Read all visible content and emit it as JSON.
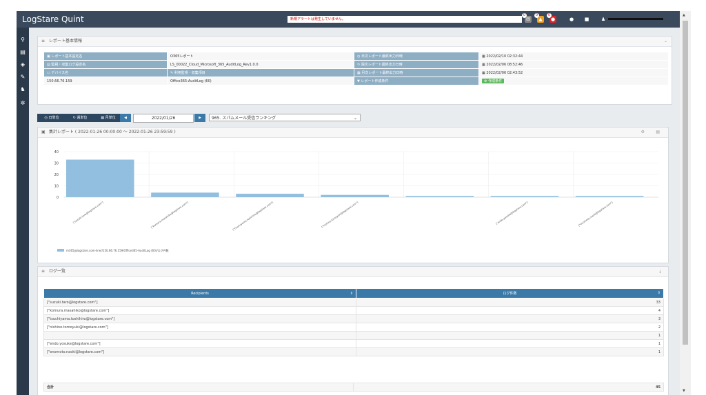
{
  "app": {
    "title": "LogStare Quint",
    "alert": "新規アラートは発生していません。"
  },
  "toolbar": {
    "badges": [
      "0",
      "0",
      "0"
    ],
    "user_name": "■■■■■■■■■■■■■■■■"
  },
  "basic_info": {
    "heading": "レポート基本情報",
    "rows": [
      {
        "l1": "レポート基本設定名",
        "v1": "O365レポート",
        "l2": "日次レポート最終出力日時",
        "v2": "2022/02/10 02:32:44"
      },
      {
        "l1": "監視・収集ログ設定名",
        "v1": "LS_00022_Cloud_Microsoft_365_AuditLog_Rev1.0.0",
        "l2": "週次レポート最終出力日時",
        "v2": "2022/02/06 08:52:46"
      },
      {
        "l1": "デバイス名",
        "v1": "利用監視・収集項目",
        "l2": "月次レポート最終出力日時",
        "v2": "2022/02/06 02:43:52"
      },
      {
        "l1": "150.66.76.159",
        "v1": "Office365-AuditLog (60)",
        "l2": "レポート作成条件",
        "v2": "作成条件"
      }
    ]
  },
  "controls": {
    "daily": "日単位",
    "weekly": "週単位",
    "monthly": "月単位",
    "date": "2022/01/26",
    "report": "965. スパムメール受信ランキング"
  },
  "summary": {
    "heading": "集計レポート ( 2022-01-26 00:00:00 ～ 2022-01-26 23:59:59 )"
  },
  "chart_data": {
    "type": "bar",
    "categories": [
      "[\"suzuki.taro@logstare.com\"]",
      "[\"komura.masahiko@logstare.com\"]",
      "[\"tsuchiyama.toshihiro@logstare.com\"]",
      "[\"nishino.tomoyuki@logstare.com\"]",
      "",
      "[\"endo.yosuke@logstare.com\"]",
      "[\"enomoto.naoki@logstare.com\"]"
    ],
    "values": [
      33,
      4,
      3,
      2,
      1,
      1,
      1
    ],
    "ylim": [
      0,
      40
    ],
    "yticks": [
      0,
      10,
      20,
      30,
      40
    ],
    "grid": true,
    "legend": "bottom-left",
    "bar_color": "#92bfdf",
    "series": [
      {
        "name": "m365@logstare.com-line//150.66.76.159/Office365-AuditLog (60)/ログ件数",
        "values": [
          33,
          4,
          3,
          2,
          1,
          1,
          1
        ]
      }
    ]
  },
  "log_list": {
    "heading": "ログ一覧",
    "columns": [
      "Recipients",
      "ログ件数"
    ],
    "rows": [
      {
        "r": "[\"suzuki.taro@logstare.com\"]",
        "c": "33"
      },
      {
        "r": "[\"komura.masahiko@logstare.com\"]",
        "c": "4"
      },
      {
        "r": "[\"tsuchiyama.toshihiro@logstare.com\"]",
        "c": "3"
      },
      {
        "r": "[\"nishino.tomoyuki@logstare.com\"]",
        "c": "2"
      },
      {
        "r": "",
        "c": "1"
      },
      {
        "r": "[\"endo.yosuke@logstare.com\"]",
        "c": "1"
      },
      {
        "r": "[\"enomoto.naoki@logstare.com\"]",
        "c": "1"
      }
    ],
    "total_label": "合計",
    "total": "45"
  }
}
